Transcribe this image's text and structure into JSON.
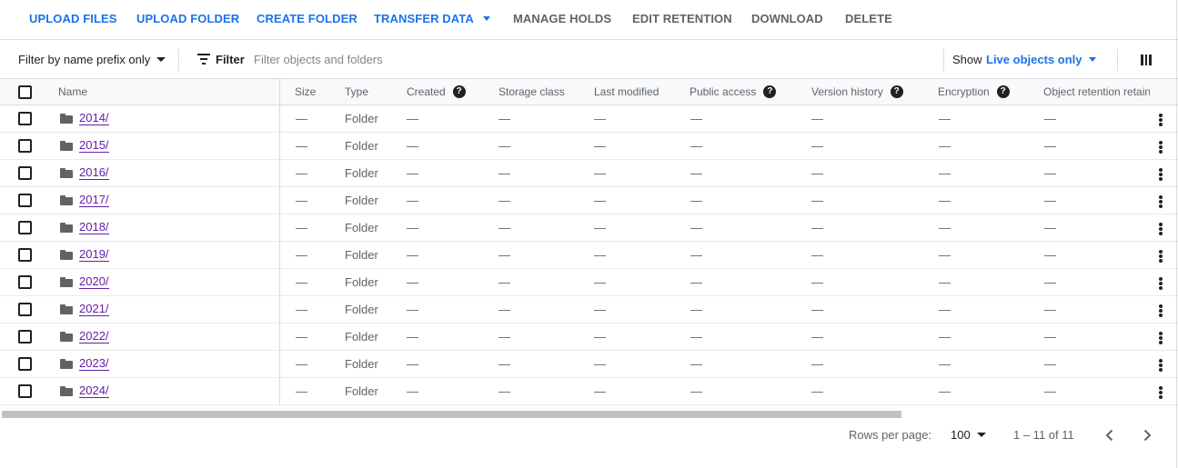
{
  "toolbar": {
    "upload_files": "UPLOAD FILES",
    "upload_folder": "UPLOAD FOLDER",
    "create_folder": "CREATE FOLDER",
    "transfer_data": "TRANSFER DATA",
    "manage_holds": "MANAGE HOLDS",
    "edit_retention": "EDIT RETENTION",
    "download": "DOWNLOAD",
    "delete": "DELETE"
  },
  "filterbar": {
    "prefix_dropdown": "Filter by name prefix only",
    "filter_label": "Filter",
    "filter_placeholder": "Filter objects and folders",
    "show_label": "Show",
    "show_value": "Live objects only"
  },
  "table": {
    "columns": {
      "name": "Name",
      "size": "Size",
      "type": "Type",
      "created": "Created",
      "storage_class": "Storage class",
      "last_modified": "Last modified",
      "public_access": "Public access",
      "version_history": "Version history",
      "encryption": "Encryption",
      "object_retention": "Object retention retain"
    },
    "empty": "—",
    "rows": [
      {
        "name": "2014/",
        "type": "Folder"
      },
      {
        "name": "2015/",
        "type": "Folder"
      },
      {
        "name": "2016/",
        "type": "Folder"
      },
      {
        "name": "2017/",
        "type": "Folder"
      },
      {
        "name": "2018/",
        "type": "Folder"
      },
      {
        "name": "2019/",
        "type": "Folder"
      },
      {
        "name": "2020/",
        "type": "Folder"
      },
      {
        "name": "2021/",
        "type": "Folder"
      },
      {
        "name": "2022/",
        "type": "Folder"
      },
      {
        "name": "2023/",
        "type": "Folder"
      },
      {
        "name": "2024/",
        "type": "Folder"
      }
    ]
  },
  "pagination": {
    "rows_per_page_label": "Rows per page:",
    "rows_per_page_value": "100",
    "range": "1 – 11 of 11"
  },
  "icons": {
    "help": "?"
  },
  "colors": {
    "accent": "#1a73e8",
    "visited_link": "#681da8"
  }
}
